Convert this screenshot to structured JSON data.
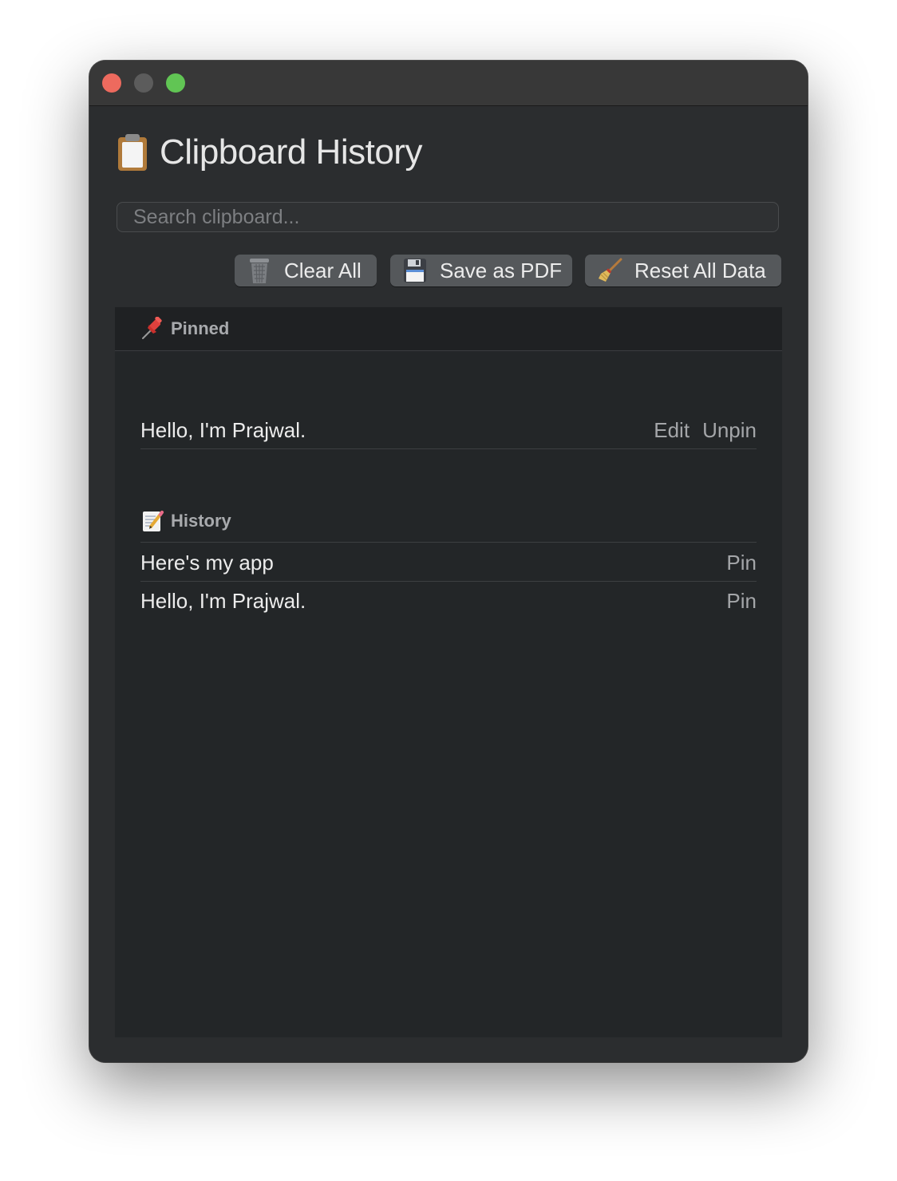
{
  "app": {
    "title": "Clipboard History",
    "title_icon": "clipboard-icon"
  },
  "search": {
    "placeholder": "Search clipboard...",
    "value": ""
  },
  "toolbar": {
    "clear_all": {
      "label": "Clear All",
      "icon": "trash-icon"
    },
    "save_pdf": {
      "label": "Save as PDF",
      "icon": "floppy-disk-icon"
    },
    "reset": {
      "label": "Reset All Data",
      "icon": "broom-icon"
    }
  },
  "pinned": {
    "label": "Pinned",
    "icon": "pushpin-icon",
    "items": [
      {
        "text": "Hello, I'm Prajwal.",
        "edit_label": "Edit",
        "unpin_label": "Unpin"
      }
    ]
  },
  "history": {
    "label": "History",
    "icon": "memo-icon",
    "items": [
      {
        "text": "Here's my app",
        "pin_label": "Pin"
      },
      {
        "text": "Hello, I'm Prajwal.",
        "pin_label": "Pin"
      }
    ]
  },
  "colors": {
    "window_bg": "#2b2d2f",
    "content_bg": "#232628",
    "close": "#ed6a5e",
    "minimize": "#5c5c5c",
    "maximize": "#61c554",
    "button_bg": "#55585b"
  }
}
